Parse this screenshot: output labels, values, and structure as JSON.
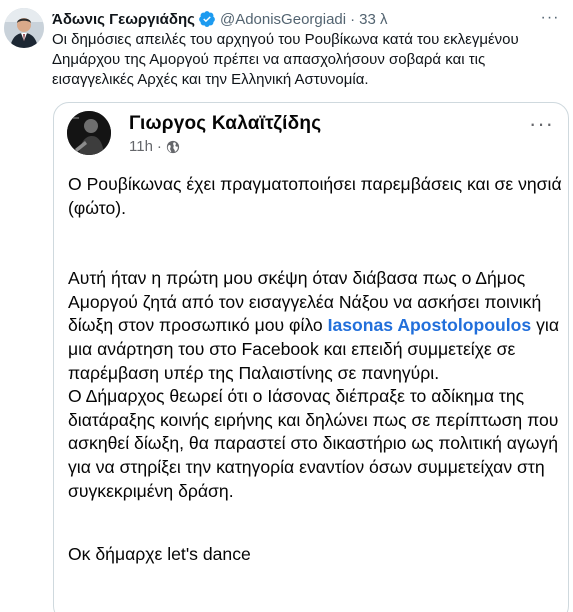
{
  "tweet": {
    "display_name": "Άδωνις Γεωργιάδης",
    "handle": "@AdonisGeorgiadi",
    "separator": "·",
    "time": "33 λ",
    "more_label": "···",
    "text": "Οι δημόσιες απειλές του αρχηγού του Ρουβίκωνα κατά του εκλεγμένου Δημάρχου της Αμοργού πρέπει να απασχολήσουν σοβαρά και τις εισαγγελικές Αρχές και την Ελληνική Αστυνομία.",
    "verified_icon": "verified-badge-icon",
    "verified_color": "#1d9bf0"
  },
  "embedded_post": {
    "author": "Γιωργος Καλαϊτζίδης",
    "time": "11h",
    "separator": "·",
    "audience_icon": "globe-icon",
    "more_label": "···",
    "paragraph1": "Ο Ρουβίκωνας έχει πραγματοποιήσει παρεμβάσεις και σε νησιά (φώτο).",
    "paragraph2_before": "Αυτή ήταν η πρώτη μου σκέψη όταν διάβασα πως ο Δήμος Αμοργού ζητά από τον εισαγγελέα Νάξου να ασκήσει ποινική δίωξη στον προσωπικό μου φίλο",
    "mention": "Iasonas Apostolopoulos",
    "paragraph2_after": " για μια ανάρτηση του στο Facebook και επειδή συμμετείχε σε παρέμβαση υπέρ της Παλαιστίνης σε πανηγύρι.",
    "paragraph3": "Ο Δήμαρχος θεωρεί ότι ο Ιάσονας διέπραξε το αδίκημα της διατάραξης κοινής ειρήνης και δηλώνει πως σε περίπτωση που ασκηθεί δίωξη, θα παραστεί στο δικαστήριο ως πολιτική αγωγή για να στηρίξει την κατηγορία εναντίον όσων συμμετείχαν στη συγκεκριμένη δράση.",
    "paragraph4": "Οκ δήμαρχε let's dance",
    "mention_color": "#216fdb"
  }
}
